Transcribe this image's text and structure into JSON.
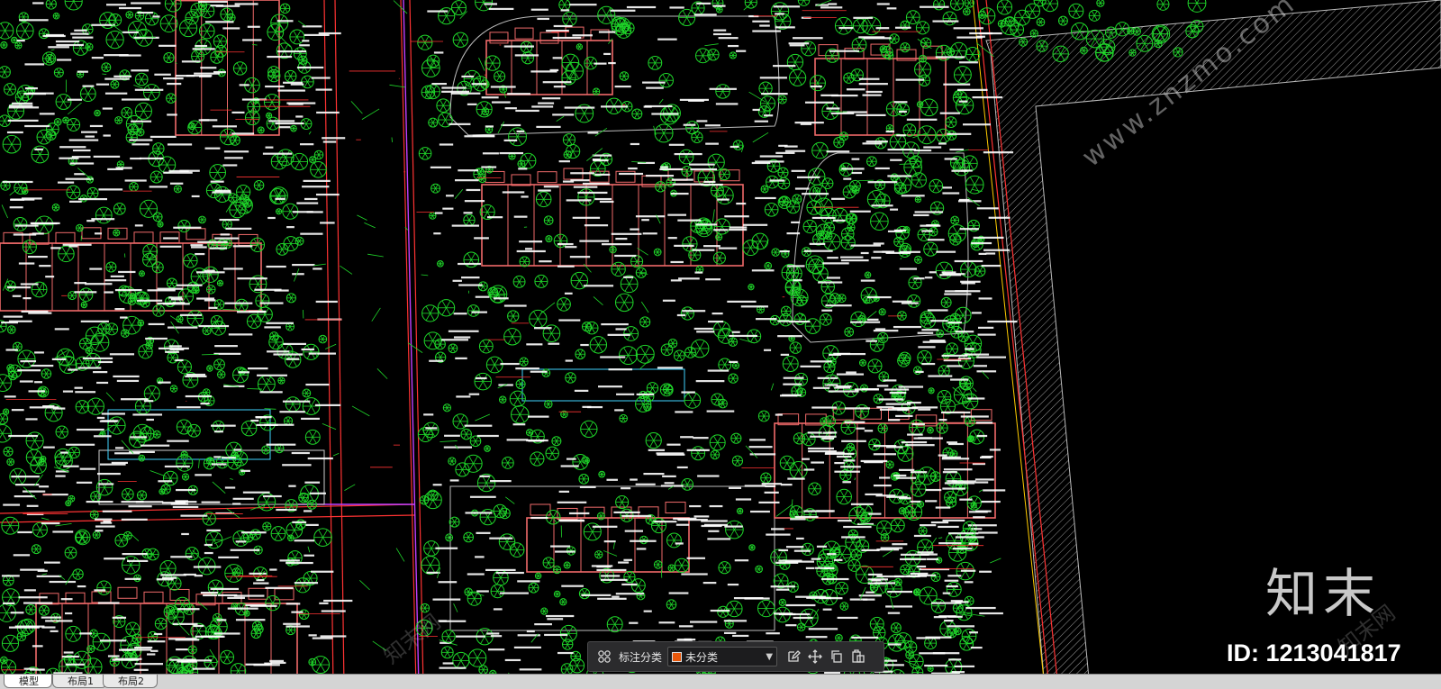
{
  "toolbar": {
    "label": "标注分类",
    "category": "未分类",
    "category_color": "#e8570b"
  },
  "tabs": [
    {
      "label": "模型"
    },
    {
      "label": "布局1"
    },
    {
      "label": "布局2"
    }
  ],
  "watermark": {
    "logo": "知末",
    "id": "ID: 1213041817",
    "diagonal": "www.znzmo.com",
    "faint": "知末网"
  },
  "cad_colors": {
    "background": "#000000",
    "building": "#f06a6a",
    "tree": "#1fd82a",
    "road": "#ff3333",
    "text": "#ffffff",
    "line": "#bcbcbc",
    "water": "#3fd3ff",
    "magenta": "#c040ff",
    "yellow": "#ffcc00"
  }
}
